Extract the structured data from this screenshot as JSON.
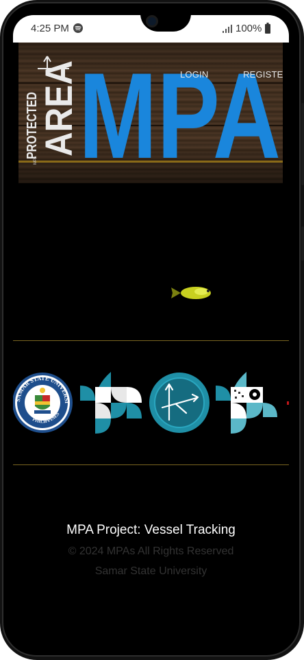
{
  "status_bar": {
    "time": "4:25 PM",
    "battery": "100%",
    "icons": [
      "spotify-icon",
      "signal-icon",
      "battery-icon"
    ]
  },
  "banner": {
    "logo_text": "MPA",
    "side_text_line1": "PROTECTED",
    "side_text_line2": "AREA",
    "small_mark": "MPA",
    "nav": {
      "login": "LOGIN",
      "register": "REGISTER"
    },
    "colors": {
      "logo_blue": "#1a86dc",
      "wood": "#3f2d1e",
      "side_text": "#eaeaea"
    }
  },
  "hero": {
    "image": "fish-icon",
    "fish_color": "#c8d020"
  },
  "partner_logos": [
    {
      "name": "samar-state-university-seal",
      "text": "SAMAR STATE UNIVERSITY",
      "bottom_text": "PHILIPPINES"
    },
    {
      "name": "quadrant-logo"
    },
    {
      "name": "compass-logo"
    },
    {
      "name": "gear-quadrant-logo"
    }
  ],
  "footer": {
    "title": "MPA Project: Vessel Tracking",
    "copyright": "© 2024 MPAs All Rights Reserved",
    "university": "Samar State University"
  },
  "colors": {
    "accent_line": "#7a6520",
    "teal": "#1f8fa6"
  }
}
